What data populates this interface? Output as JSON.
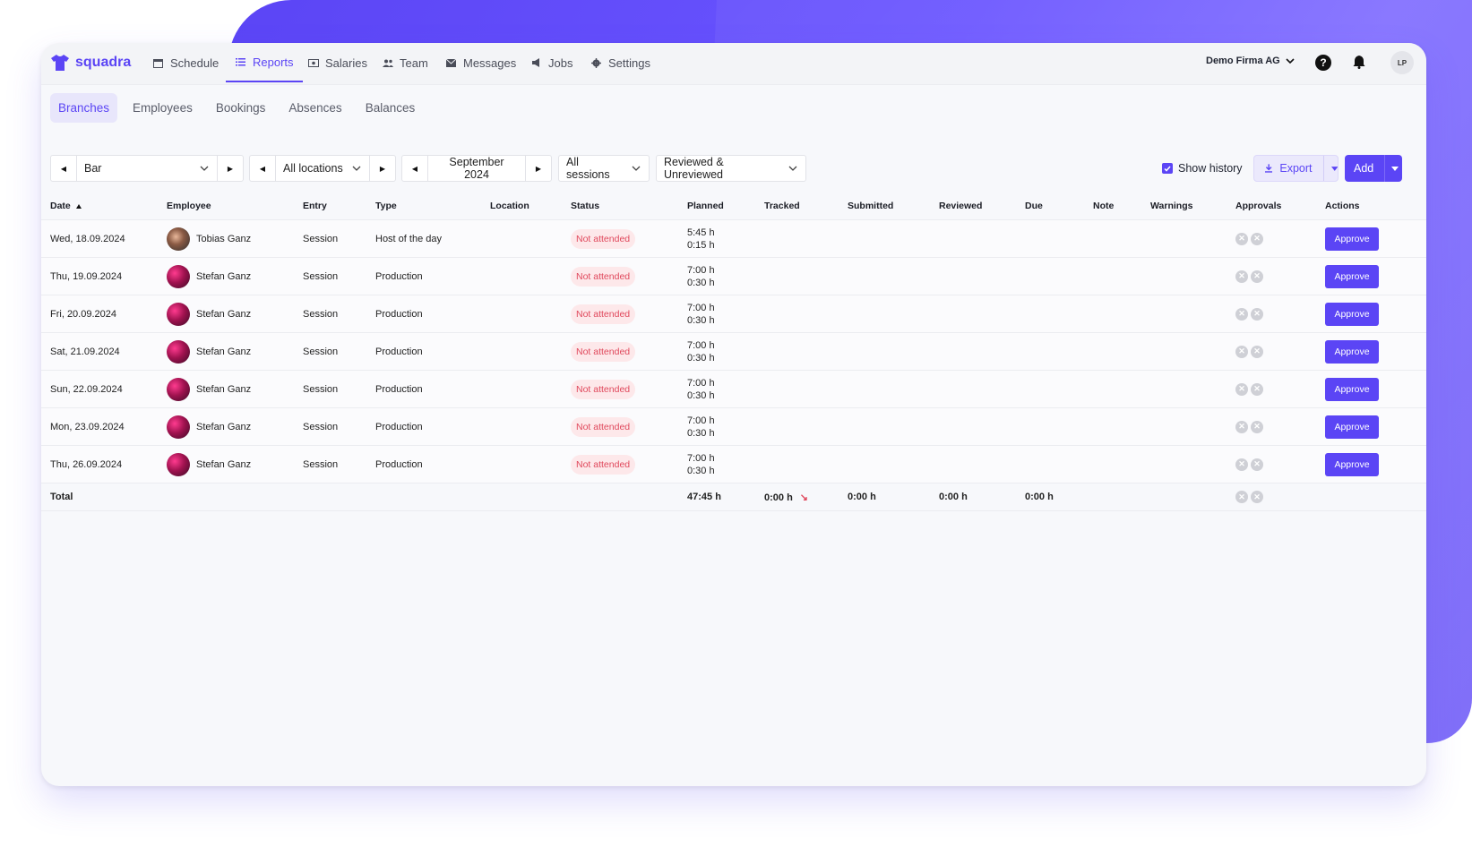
{
  "app": {
    "logo_text": "squadra",
    "brand_color": "#5b45f5"
  },
  "nav": {
    "items": [
      {
        "label": "Schedule",
        "icon": "calendar-icon"
      },
      {
        "label": "Reports",
        "icon": "list-icon",
        "active": true
      },
      {
        "label": "Salaries",
        "icon": "money-icon"
      },
      {
        "label": "Team",
        "icon": "people-icon"
      },
      {
        "label": "Messages",
        "icon": "mail-icon"
      },
      {
        "label": "Jobs",
        "icon": "megaphone-icon"
      },
      {
        "label": "Settings",
        "icon": "gear-icon"
      }
    ],
    "company": "Demo Firma AG",
    "help": "?",
    "user_initials": "LP"
  },
  "subtabs": [
    {
      "label": "Branches",
      "active": true
    },
    {
      "label": "Employees"
    },
    {
      "label": "Bookings"
    },
    {
      "label": "Absences"
    },
    {
      "label": "Balances"
    }
  ],
  "filters": {
    "branch": "Bar",
    "location": "All locations",
    "period": "September 2024",
    "sessions": "All sessions",
    "review": "Reviewed & Unreviewed",
    "show_history": "Show history",
    "export": "Export",
    "add": "Add"
  },
  "table": {
    "headers": [
      "Date",
      "Employee",
      "Entry",
      "Type",
      "Location",
      "Status",
      "Planned",
      "Tracked",
      "Submitted",
      "Reviewed",
      "Due",
      "Note",
      "Warnings",
      "Approvals",
      "Actions"
    ],
    "rows": [
      {
        "date": "Wed, 18.09.2024",
        "employee": "Tobias Ganz",
        "entry": "Session",
        "type": "Host of the day",
        "status": "Not attended",
        "planned1": "5:45 h",
        "planned2": "0:15 h",
        "action": "Approve"
      },
      {
        "date": "Thu, 19.09.2024",
        "employee": "Stefan Ganz",
        "entry": "Session",
        "type": "Production",
        "status": "Not attended",
        "planned1": "7:00 h",
        "planned2": "0:30 h",
        "action": "Approve"
      },
      {
        "date": "Fri, 20.09.2024",
        "employee": "Stefan Ganz",
        "entry": "Session",
        "type": "Production",
        "status": "Not attended",
        "planned1": "7:00 h",
        "planned2": "0:30 h",
        "action": "Approve"
      },
      {
        "date": "Sat, 21.09.2024",
        "employee": "Stefan Ganz",
        "entry": "Session",
        "type": "Production",
        "status": "Not attended",
        "planned1": "7:00 h",
        "planned2": "0:30 h",
        "action": "Approve"
      },
      {
        "date": "Sun, 22.09.2024",
        "employee": "Stefan Ganz",
        "entry": "Session",
        "type": "Production",
        "status": "Not attended",
        "planned1": "7:00 h",
        "planned2": "0:30 h",
        "action": "Approve"
      },
      {
        "date": "Mon, 23.09.2024",
        "employee": "Stefan Ganz",
        "entry": "Session",
        "type": "Production",
        "status": "Not attended",
        "planned1": "7:00 h",
        "planned2": "0:30 h",
        "action": "Approve"
      },
      {
        "date": "Thu, 26.09.2024",
        "employee": "Stefan Ganz",
        "entry": "Session",
        "type": "Production",
        "status": "Not attended",
        "planned1": "7:00 h",
        "planned2": "0:30 h",
        "action": "Approve"
      }
    ],
    "total": {
      "label": "Total",
      "planned": "47:45 h",
      "tracked": "0:00 h",
      "submitted": "0:00 h",
      "reviewed": "0:00 h",
      "due": "0:00 h"
    }
  }
}
